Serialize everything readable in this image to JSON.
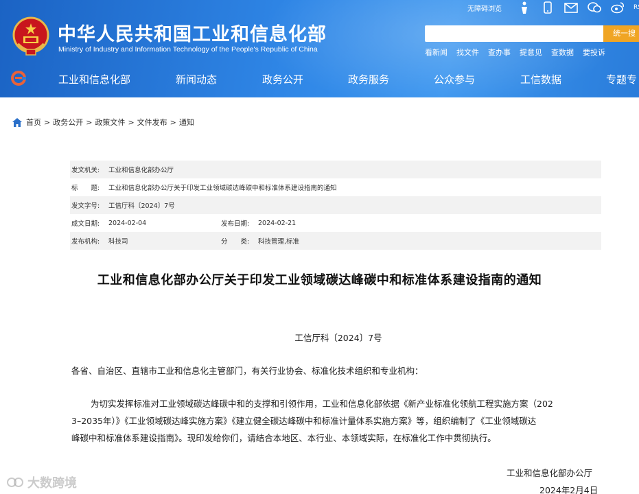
{
  "header": {
    "title_cn": "中华人民共和国工业和信息化部",
    "title_en": "Ministry of Industry and Information Technology of the People's Republic of China",
    "accessibility_label": "无障碍浏览",
    "rss_label": "RS",
    "search_placeholder": "",
    "search_button": "统一搜",
    "quick_links": [
      "看新闻",
      "找文件",
      "查办事",
      "提意见",
      "查数据",
      "要投诉"
    ],
    "nav": [
      "工业和信息化部",
      "新闻动态",
      "政务公开",
      "政务服务",
      "公众参与",
      "工信数据",
      "专题专"
    ],
    "colors": {
      "header_blue": "#2a7cda",
      "search_orange": "#f0a524"
    }
  },
  "breadcrumb": [
    "首页",
    "政务公开",
    "政策文件",
    "文件发布",
    "通知"
  ],
  "breadcrumb_separator": ">",
  "meta": {
    "issuer_label": "发文机关:",
    "issuer": "工业和信息化部办公厅",
    "title_label": "标　　题:",
    "title": "工业和信息化部办公厅关于印发工业领域碳达峰碳中和标准体系建设指南的通知",
    "doc_no_label": "发文字号:",
    "doc_no": "工信厅科〔2024〕7号",
    "created_label": "成文日期:",
    "created": "2024-02-04",
    "published_label": "发布日期:",
    "published": "2024-02-21",
    "org_label": "发布机构:",
    "org": "科技司",
    "category_label": "分　　类:",
    "category": "科技管理,标准"
  },
  "article": {
    "title": "工业和信息化部办公厅关于印发工业领域碳达峰碳中和标准体系建设指南的通知",
    "doc_number": "工信厅科〔2024〕7号",
    "addressee": "各省、自治区、直辖市工业和信息化主管部门，有关行业协会、标准化技术组织和专业机构：",
    "body_lines": [
      "为切实发挥标准对工业领域碳达峰碳中和的支撑和引领作用，工业和信息化部依据《新产业标准化领航工程实施方案（202",
      "3–2035年）》《工业领域碳达峰实施方案》《建立健全碳达峰碳中和标准计量体系实施方案》等，组织编制了《工业领域碳达",
      "峰碳中和标准体系建设指南》。现印发给你们，请结合本地区、本行业、本领域实际，在标准化工作中贯彻执行。"
    ],
    "signer": "工业和信息化部办公厅",
    "sign_date": "2024年2月4日"
  },
  "watermark": "大数跨境"
}
